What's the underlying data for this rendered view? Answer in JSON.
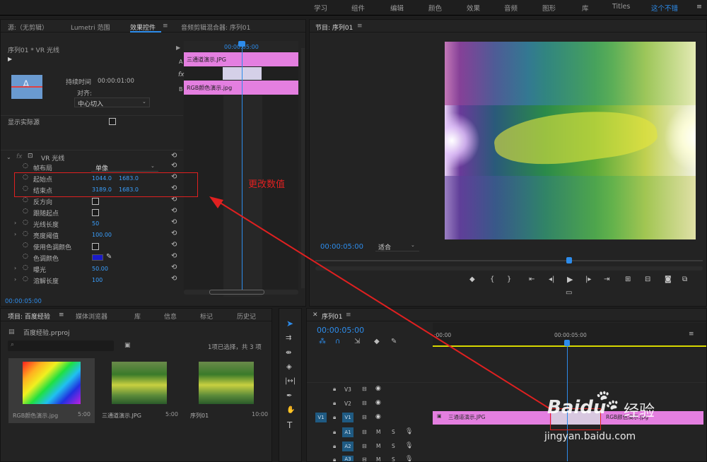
{
  "topnav": {
    "items": [
      "学习",
      "组件",
      "编辑",
      "颜色",
      "效果",
      "音频",
      "图形",
      "库",
      "Titles"
    ],
    "active": "这个不错",
    "menu": "≡"
  },
  "effect_panel": {
    "tabs": [
      "源:（无剪辑）",
      "Lumetri 范围",
      "效果控件",
      "音频剪辑混合器: 序列01"
    ],
    "menu": "≡",
    "seq_label": "序列01 * VR 光线",
    "timecode_head": "00:00:05:00",
    "clip_a": "三通道演示.JPG",
    "clip_b": "RGB颜色演示.jpg",
    "label_a": "A",
    "label_b": "B",
    "fx": "fx",
    "thumb_letter": "A",
    "duration_label": "持续时间",
    "duration_value": "00:00:01:00",
    "align_label": "对齐:",
    "align_value": "中心切入",
    "show_source": "显示实际源",
    "effect_name": "VR 光线",
    "props": [
      {
        "label": "帧布局",
        "v1": "单像"
      },
      {
        "label": "起始点",
        "v1": "1044.0",
        "v2": "1683.0"
      },
      {
        "label": "结束点",
        "v1": "3189.0",
        "v2": "1683.0"
      },
      {
        "label": "反方向"
      },
      {
        "label": "跟随起点"
      },
      {
        "label": "光线长度",
        "v1": "50"
      },
      {
        "label": "亮度阈值",
        "v1": "100.00"
      },
      {
        "label": "使用色调颜色"
      },
      {
        "label": "色调颜色"
      },
      {
        "label": "曝光",
        "v1": "50.00"
      },
      {
        "label": "溶解长度",
        "v1": "100"
      }
    ],
    "annotation": "更改数值",
    "bottom_timecode": "00:00:05:00"
  },
  "program": {
    "title": "节目: 序列01",
    "menu": "≡",
    "timecode": "00:00:05:00",
    "fit": "适合",
    "tint_color": "#1a1ac8"
  },
  "project": {
    "tabs": [
      "项目: 百度经验",
      "媒体浏览器",
      "库",
      "信息",
      "标记",
      "历史记"
    ],
    "file": "百度经验.prproj",
    "status": "1项已选择，共 3 项",
    "items": [
      {
        "name": "RGB颜色演示.jpg",
        "dur": "5:00"
      },
      {
        "name": "三通道演示.JPG",
        "dur": "5:00"
      },
      {
        "name": "序列01",
        "dur": "10:00"
      }
    ]
  },
  "timeline": {
    "title": "序列01",
    "menu": "≡",
    "timecode": "00:00:05:00",
    "ruler": [
      ":00:00",
      "00:00:05:00"
    ],
    "tracks": [
      {
        "id": "V3",
        "src": ""
      },
      {
        "id": "V2",
        "src": ""
      },
      {
        "id": "V1",
        "src": "V1"
      },
      {
        "id": "A1",
        "src": ""
      },
      {
        "id": "A2",
        "src": ""
      },
      {
        "id": "A3",
        "src": ""
      }
    ],
    "clip1": "三通道演示.JPG",
    "clip2": "RGB颜色演示.jpg",
    "mute": "M",
    "solo": "S"
  },
  "watermark": {
    "brand": "Baidu",
    "brand_cn": "经验",
    "url": "jingyan.baidu.com"
  }
}
